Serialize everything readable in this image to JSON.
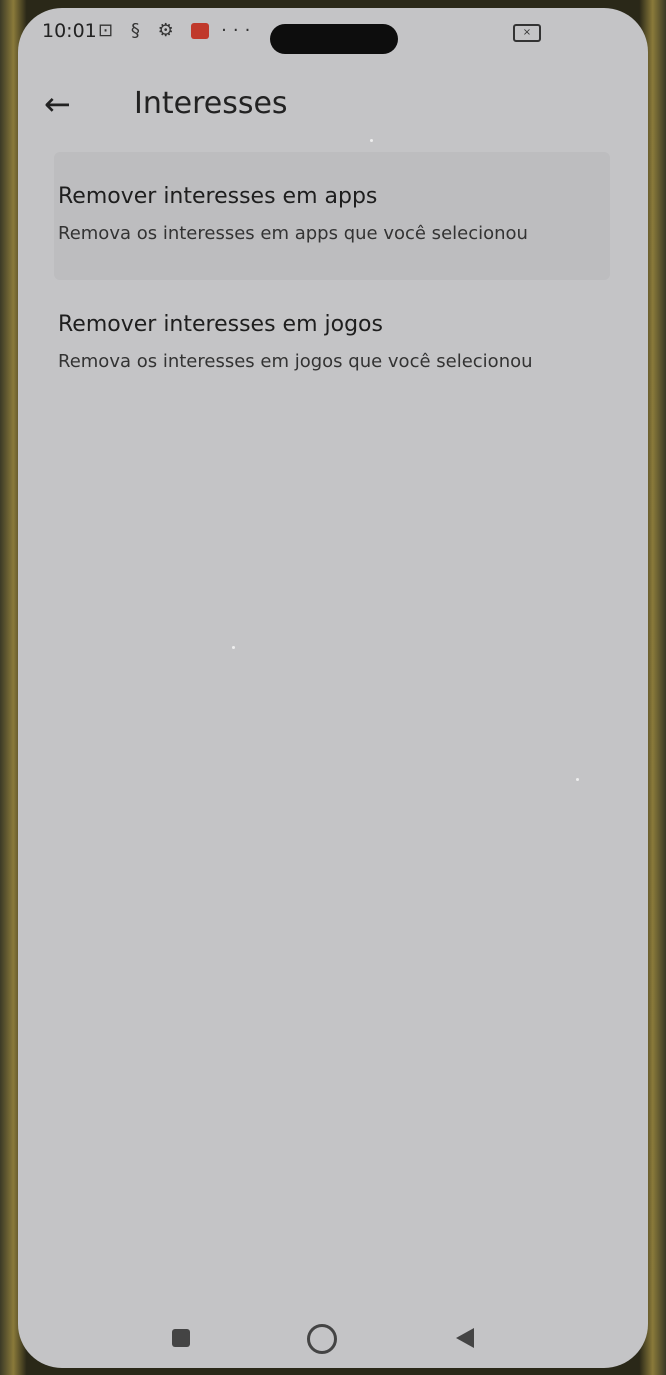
{
  "status_bar": {
    "time": "10:01",
    "icons": [
      "nfc-icon",
      "s-icon",
      "gear-icon",
      "mail-icon",
      "more-icon"
    ],
    "more": "···"
  },
  "app_bar": {
    "back_icon": "←",
    "title": "Interesses"
  },
  "items": [
    {
      "title": "Remover interesses em apps",
      "subtitle": "Remova os interesses em apps que você selecionou"
    },
    {
      "title": "Remover interesses em jogos",
      "subtitle": "Remova os interesses em jogos que você selecionou"
    }
  ],
  "colors": {
    "screen_bg": "#c4c4c6",
    "card_bg": "#bdbdbf",
    "text": "#1e1e1e"
  }
}
